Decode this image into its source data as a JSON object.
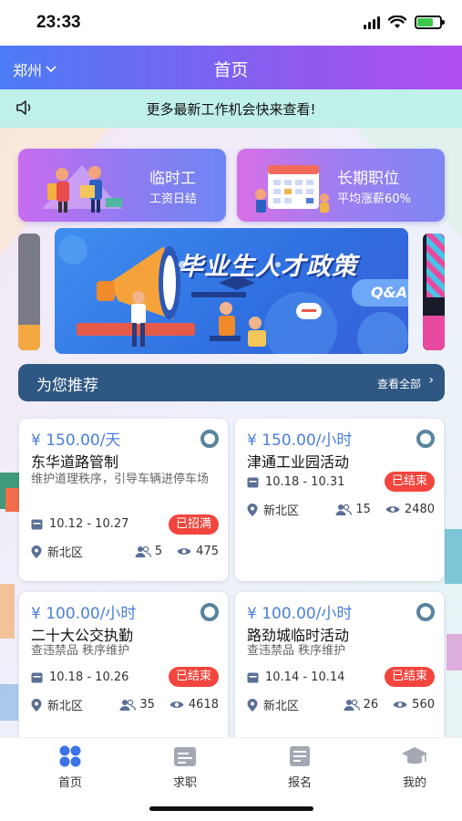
{
  "status_bar": {
    "time": "23:33"
  },
  "header": {
    "city": "郑州",
    "title": "首页"
  },
  "notice": {
    "text": "更多最新工作机会快来查看!"
  },
  "categories": [
    {
      "title": "临时工",
      "subtitle": "工资日结"
    },
    {
      "title": "长期职位",
      "subtitle": "平均涨薪60%"
    }
  ],
  "banner": {
    "title": "毕业生人才政策",
    "tag": "Q&A"
  },
  "recommend": {
    "title": "为您推荐",
    "view_all": "查看全部"
  },
  "jobs": [
    {
      "price": "¥ 150.00/天",
      "title": "东华道路管制",
      "desc": "维护道理秩序，引导车辆进停车场",
      "date": "10.12 - 10.27",
      "status": "已招满",
      "location": "新北区",
      "people": "5",
      "views": "475"
    },
    {
      "price": "¥ 150.00/小时",
      "title": "津通工业园活动",
      "desc": "",
      "date": "10.18 - 10.31",
      "status": "已结束",
      "location": "新北区",
      "people": "15",
      "views": "2480"
    },
    {
      "price": "¥ 100.00/小时",
      "title": "二十大公交执勤",
      "desc": "查违禁品 秩序维护",
      "date": "10.18 - 10.26",
      "status": "已结束",
      "location": "新北区",
      "people": "35",
      "views": "4618"
    },
    {
      "price": "¥ 100.00/小时",
      "title": "路劲城临时活动",
      "desc": "查违禁品 秩序维护",
      "date": "10.14 - 10.14",
      "status": "已结束",
      "location": "新北区",
      "people": "26",
      "views": "560"
    }
  ],
  "tabs": [
    {
      "label": "首页",
      "icon": "home-grid-icon",
      "active": true
    },
    {
      "label": "求职",
      "icon": "briefcase-icon",
      "active": false
    },
    {
      "label": "报名",
      "icon": "register-icon",
      "active": false
    },
    {
      "label": "我的",
      "icon": "graduation-cap-icon",
      "active": false
    }
  ],
  "colors": {
    "accent": "#4a7fd8",
    "status_red": "#f2453d",
    "recommend_bg": "#2e5783",
    "notice_bg": "#bff0ea",
    "active_tab": "#3b73e8"
  }
}
